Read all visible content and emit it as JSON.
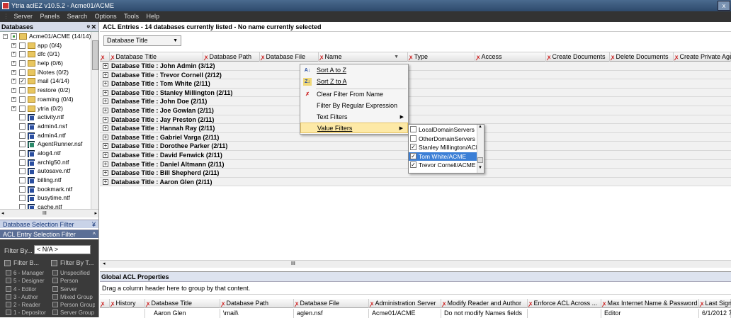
{
  "window": {
    "title": "Ytria aclEZ v10.5.2 - Acme01/ACME"
  },
  "menu": [
    "Server",
    "Panels",
    "Search",
    "Options",
    "Tools",
    "Help"
  ],
  "left": {
    "header": "Databases",
    "tree": [
      {
        "label": "Acme01/ACME (14/14)",
        "kind": "root",
        "check": "partial",
        "indent": 0
      },
      {
        "label": "app (0/4)",
        "kind": "folder",
        "check": "",
        "indent": 1
      },
      {
        "label": "dfc (0/1)",
        "kind": "folder",
        "check": "",
        "indent": 1
      },
      {
        "label": "help (0/6)",
        "kind": "folder",
        "check": "",
        "indent": 1
      },
      {
        "label": "iNotes (0/2)",
        "kind": "folder",
        "check": "",
        "indent": 1
      },
      {
        "label": "mail (14/14)",
        "kind": "folder",
        "check": "✓",
        "indent": 1
      },
      {
        "label": "restore (0/2)",
        "kind": "folder",
        "check": "",
        "indent": 1
      },
      {
        "label": "roaming (0/4)",
        "kind": "folder",
        "check": "",
        "indent": 1
      },
      {
        "label": "ytria (0/2)",
        "kind": "folder",
        "check": "",
        "indent": 1
      },
      {
        "label": "activity.ntf",
        "kind": "db",
        "check": "",
        "indent": 1
      },
      {
        "label": "admin4.nsf",
        "kind": "db",
        "check": "",
        "indent": 1
      },
      {
        "label": "admin4.ntf",
        "kind": "db",
        "check": "",
        "indent": 1
      },
      {
        "label": "AgentRunner.nsf",
        "kind": "agent",
        "check": "",
        "indent": 1
      },
      {
        "label": "alog4.ntf",
        "kind": "db",
        "check": "",
        "indent": 1
      },
      {
        "label": "archlg50.ntf",
        "kind": "db",
        "check": "",
        "indent": 1
      },
      {
        "label": "autosave.ntf",
        "kind": "db",
        "check": "",
        "indent": 1
      },
      {
        "label": "billing.ntf",
        "kind": "db",
        "check": "",
        "indent": 1
      },
      {
        "label": "bookmark.ntf",
        "kind": "db",
        "check": "",
        "indent": 1
      },
      {
        "label": "busytime.ntf",
        "kind": "db",
        "check": "",
        "indent": 1
      },
      {
        "label": "cache.ntf",
        "kind": "db",
        "check": "",
        "indent": 1
      }
    ],
    "hscroll_label": "III",
    "db_selection_filter": "Database Selection Filter",
    "acl_selection_filter": "ACL Entry Selection Filter",
    "filter_by_label": "Filter By...",
    "filter_by_value": "< N/A >",
    "filter_b_label": "Filter B...",
    "filter_by_t_label": "Filter By T...",
    "levels": [
      "6 - Manager",
      "5 - Designer",
      "4 - Editor",
      "3 - Author",
      "2 - Reader",
      "1 - Depositor"
    ],
    "types": [
      "Unspecified",
      "Person",
      "Server",
      "Mixed Group",
      "Person Group",
      "Server Group"
    ]
  },
  "main": {
    "acl_title": "ACL Entries - 14 databases currently listed - No name currently selected",
    "group_chip": "Database Title",
    "columns": [
      "Database Title",
      "Database Path",
      "Database File",
      "Name",
      "Type",
      "Access",
      "Create Documents",
      "Delete Documents",
      "Create Private Agents"
    ],
    "groups": [
      "Database Title : John Admin (3/12)",
      "Database Title : Trevor Cornell (2/12)",
      "Database Title : Tom White (2/11)",
      "Database Title : Stanley Millington (2/11)",
      "Database Title : John Doe (2/11)",
      "Database Title : Joe Gowlan (2/11)",
      "Database Title : Jay Preston (2/11)",
      "Database Title : Hannah Ray (2/11)",
      "Database Title : Gabriel Varga (2/11)",
      "Database Title : Dorothee Parker (2/11)",
      "Database Title : David Fenwick (2/11)",
      "Database Title : Daniel Altmann (2/11)",
      "Database Title : Bill Shepherd (2/11)",
      "Database Title : Aaron Glen (2/11)"
    ],
    "context_menu": {
      "sort_az": "Sort A to Z",
      "sort_za": "Sort Z to A",
      "clear_filter": "Clear Filter From Name",
      "filter_regex": "Filter By Regular Expression",
      "text_filters": "Text Filters",
      "value_filters": "Value Filters"
    },
    "value_filters": [
      {
        "label": "LocalDomainServers",
        "checked": ""
      },
      {
        "label": "OtherDomainServers",
        "checked": ""
      },
      {
        "label": "Stanley Millington/ACME",
        "checked": "✓"
      },
      {
        "label": "Tom White/ACME",
        "checked": "✓"
      },
      {
        "label": "Trevor Cornell/ACME",
        "checked": "✓"
      }
    ],
    "hscroll_label": "III"
  },
  "global": {
    "header": "Global ACL Properties",
    "drag_hint": "Drag a column header here to group by that content.",
    "columns": [
      "History",
      "Database Title",
      "Database Path",
      "Database File",
      "Administration Server",
      "Modify Reader and Author",
      "Enforce ACL Across ...",
      "Max Internet Name & Password",
      "Last Signature"
    ],
    "row": [
      "",
      "Aaron Glen",
      "\\mail\\",
      "aglen.nsf",
      "Acme01/ACME",
      "Do not modify Names fields",
      "",
      "Editor",
      "6/1/2012 7..."
    ]
  }
}
